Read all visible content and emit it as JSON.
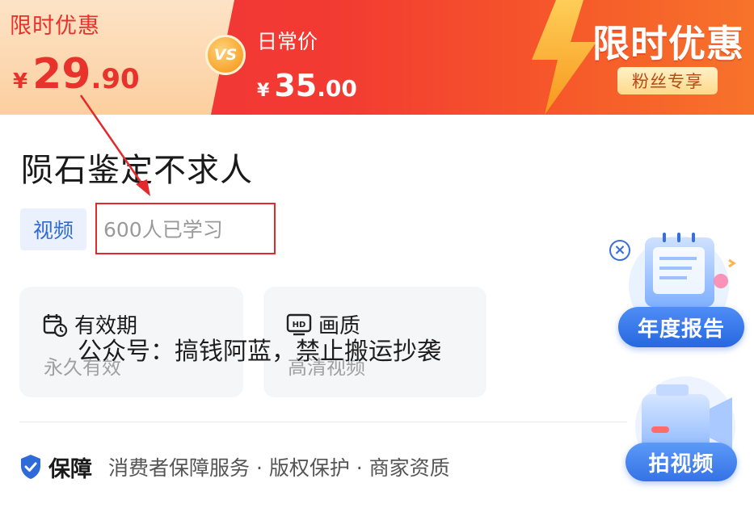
{
  "banner": {
    "limited_label": "限时优惠",
    "sale_price": {
      "currency": "¥",
      "integer": "29",
      "decimal": ".90"
    },
    "vs_label": "VS",
    "daily_label": "日常价",
    "daily_price": {
      "currency": "¥",
      "integer": "35",
      "decimal": ".00"
    },
    "title": "限时优惠",
    "fans_tag": "粉丝专享"
  },
  "course": {
    "title": "陨石鉴定不求人",
    "type_tag": "视频",
    "learners": "600人已学习"
  },
  "cards": {
    "validity": {
      "label": "有效期",
      "value": "永久有效",
      "icon": "calendar-clock-icon"
    },
    "quality": {
      "label": "画质",
      "value": "高清视频",
      "icon": "hd-icon"
    }
  },
  "watermark": "公众号：搞钱阿蓝，禁止搬运抄袭",
  "guarantee": {
    "title": "保障",
    "items": "消费者保障服务 · 版权保护 · 商家资质",
    "icon": "shield-check-icon"
  },
  "floating": {
    "report_label": "年度报告",
    "close_icon": "close-icon",
    "video_label": "拍视频"
  },
  "colors": {
    "accent_red": "#e8322c",
    "banner_red": "#f0323a",
    "brand_blue": "#2f6bd8",
    "tag_bg": "#eaf1fd"
  }
}
